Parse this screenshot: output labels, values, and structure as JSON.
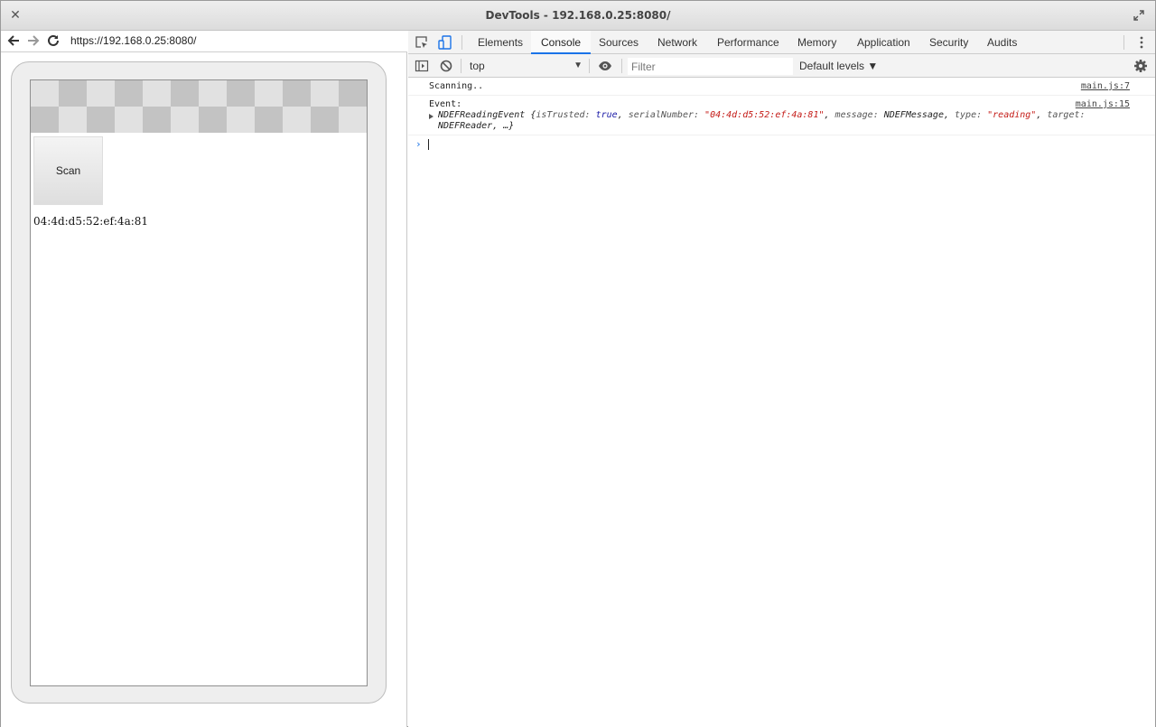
{
  "window": {
    "title": "DevTools - 192.168.0.25:8080/"
  },
  "browser": {
    "url": "https://192.168.0.25:8080/"
  },
  "page": {
    "scan_button_label": "Scan",
    "serial_number_text": "04:4d:d5:52:ef:4a:81"
  },
  "devtools": {
    "tabs": [
      {
        "label": "Elements"
      },
      {
        "label": "Console",
        "active": true
      },
      {
        "label": "Sources"
      },
      {
        "label": "Network"
      },
      {
        "label": "Performance"
      },
      {
        "label": "Memory"
      },
      {
        "label": "Application"
      },
      {
        "label": "Security"
      },
      {
        "label": "Audits"
      }
    ],
    "toolbar": {
      "context_value": "top",
      "filter_placeholder": "Filter",
      "levels_label": "Default levels ▼"
    },
    "console": {
      "messages": [
        {
          "text": "Scanning..",
          "source": "main.js:7"
        },
        {
          "text": "Event:",
          "source": "main.js:15",
          "object": {
            "class_name": "NDEFReadingEvent",
            "open": " {",
            "isTrusted_key": "isTrusted: ",
            "isTrusted_value": "true",
            "serialNumber_key": "serialNumber: ",
            "serialNumber_value": "\"04:4d:d5:52:ef:4a:81\"",
            "message_key": "message: ",
            "message_value": "NDEFMessage",
            "type_key": "type: ",
            "type_value": "\"reading\"",
            "target_key": "target: ",
            "target_value": "NDEFReader",
            "tail": ", …}",
            "sep": ", "
          }
        }
      ],
      "prompt_symbol": "›"
    }
  },
  "colors": {
    "active_tab_underline": "#1a73e8",
    "string_value": "#c41a16",
    "boolean_value": "#1a1aa6",
    "checker_dark": "#c3c3c3",
    "checker_light": "#e1e1e1"
  },
  "icons": {
    "close": "close-icon",
    "expand": "expand-icon",
    "back": "back-arrow-icon",
    "forward": "forward-arrow-icon",
    "reload": "reload-icon",
    "inspect": "inspect-element-icon",
    "device": "device-toggle-icon",
    "more": "more-vertical-icon",
    "sidebar": "console-sidebar-icon",
    "clear": "clear-console-icon",
    "eye": "live-expression-eye-icon",
    "gear": "settings-gear-icon"
  }
}
